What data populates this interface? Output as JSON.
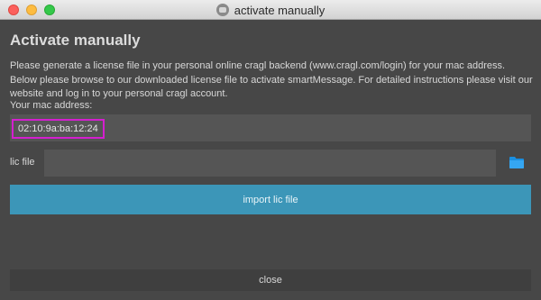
{
  "window": {
    "title": "activate manually"
  },
  "dialog": {
    "heading": "Activate manually",
    "description": "Please generate a license file in your personal online cragl backend (www.cragl.com/login) for your mac address. Below please browse to our downloaded license file to activate smartMessage. For detailed instructions please visit our website and log in to your personal cragl account.",
    "mac_label": "Your mac address:",
    "mac_value": "02:10:9a:ba:12:24",
    "lic_label": "lic file",
    "lic_value": "",
    "folder_icon": "folder-icon",
    "import_label": "import lic file",
    "close_label": "close"
  },
  "colors": {
    "accent": "#3c96b8",
    "highlight": "#d41fcf",
    "folder": "#1a8fe0"
  }
}
